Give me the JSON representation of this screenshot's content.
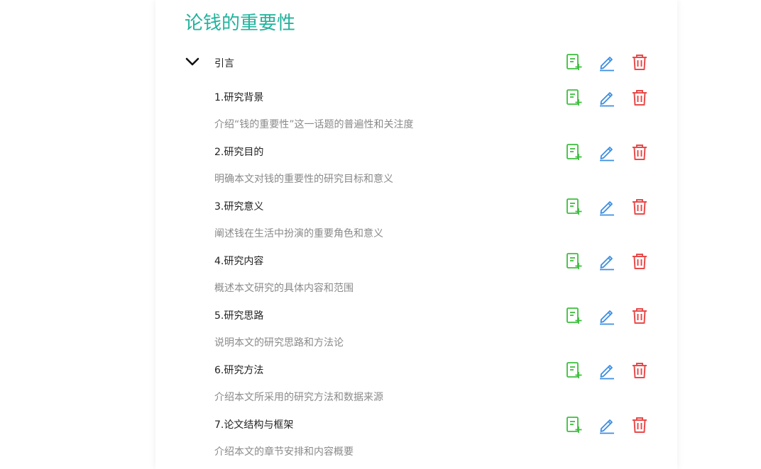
{
  "document": {
    "title": "论钱的重要性"
  },
  "colors": {
    "accent": "#21b39c",
    "add": "#3cbf3c",
    "edit": "#3c8ee0",
    "delete": "#e84a4a"
  },
  "chapter": {
    "label": "引言",
    "expand_icon": "chevron-down-icon",
    "actions": [
      "add-note-icon",
      "edit-pencil-icon",
      "trash-icon"
    ]
  },
  "items": [
    {
      "title": "1.研究背景",
      "description": "介绍“钱的重要性”这一话题的普遍性和关注度"
    },
    {
      "title": "2.研究目的",
      "description": "明确本文对钱的重要性的研究目标和意义"
    },
    {
      "title": "3.研究意义",
      "description": "阐述钱在生活中扮演的重要角色和意义"
    },
    {
      "title": "4.研究内容",
      "description": "概述本文研究的具体内容和范围"
    },
    {
      "title": "5.研究思路",
      "description": "说明本文的研究思路和方法论"
    },
    {
      "title": "6.研究方法",
      "description": "介绍本文所采用的研究方法和数据来源"
    },
    {
      "title": "7.论文结构与框架",
      "description": "介绍本文的章节安排和内容概要"
    }
  ]
}
